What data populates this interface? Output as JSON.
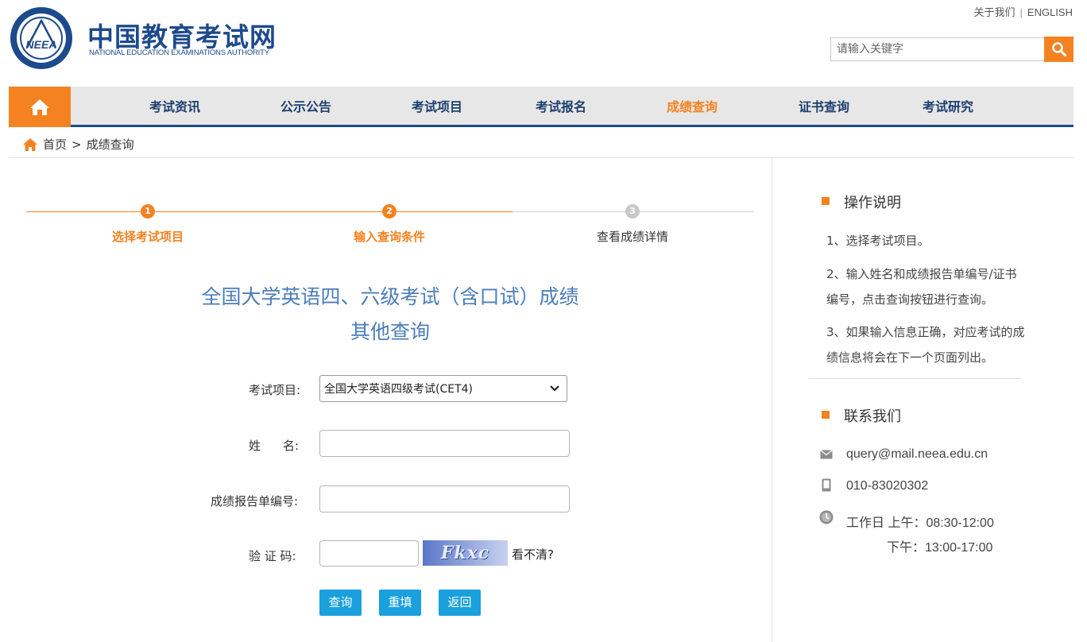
{
  "header": {
    "logo_cn": "中国教育考试网",
    "logo_en": "NATIONAL EDUCATION EXAMINATIONS AUTHORITY",
    "logo_mark": "NEEA",
    "top_links": [
      "关于我们",
      "ENGLISH"
    ],
    "top_sep": "|",
    "search_placeholder": "请输入关键字"
  },
  "nav": {
    "items": [
      "考试资讯",
      "公示公告",
      "考试项目",
      "考试报名",
      "成绩查询",
      "证书查询",
      "考试研究"
    ],
    "active_index": 4
  },
  "breadcrumb": {
    "home": "首页",
    "sep": ">",
    "current": "成绩查询"
  },
  "steps": [
    {
      "num": "1",
      "label": "选择考试项目",
      "state": "done"
    },
    {
      "num": "2",
      "label": "输入查询条件",
      "state": "current"
    },
    {
      "num": "3",
      "label": "查看成绩详情",
      "state": "todo"
    }
  ],
  "title": {
    "line1": "全国大学英语四、六级考试（含口试）成绩",
    "line2": "其他查询"
  },
  "form": {
    "exam_label": "考试项目:",
    "exam_selected": "全国大学英语四级考试(CET4)",
    "name_label_1": "姓",
    "name_label_2": "名:",
    "name_value": "",
    "report_label": "成绩报告单编号:",
    "report_value": "",
    "captcha_label": "验 证 码:",
    "captcha_value": "",
    "captcha_text": "Fkxc",
    "unclear": "看不清?",
    "buttons": {
      "query": "查询",
      "reset": "重填",
      "back": "返回"
    }
  },
  "sidebar": {
    "instructions_title": "操作说明",
    "instructions": [
      "1、选择考试项目。",
      "2、输入姓名和成绩报告单编号/证书编号，点击查询按钮进行查询。",
      "3、如果输入信息正确，对应考试的成绩信息将会在下一个页面列出。"
    ],
    "contact_title": "联系我们",
    "email": "query@mail.neea.edu.cn",
    "phone": "010-83020302",
    "hours_am": "工作日 上午：08:30-12:00",
    "hours_pm": "下午：13:00-17:00"
  },
  "colors": {
    "accent": "#f58220",
    "brand": "#1d4a8c",
    "title": "#4a7ebb",
    "button": "#1aa0dc"
  }
}
